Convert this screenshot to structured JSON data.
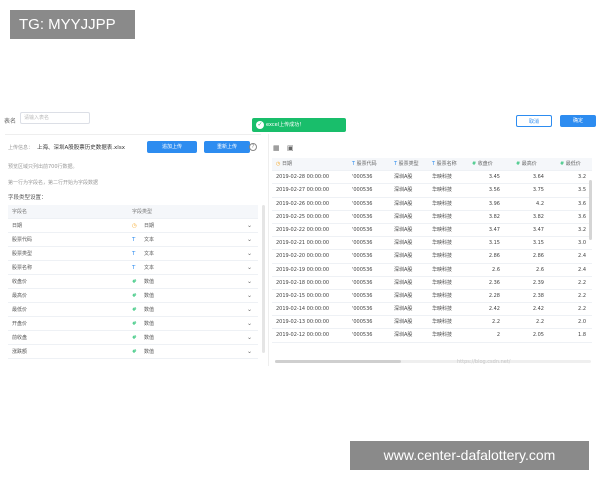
{
  "watermark_top": "TG: MYYJJPP",
  "watermark_bottom": "www.center-dafalottery.com",
  "header": {
    "tablename_label": "表名",
    "tablename_placeholder": "请输入表名",
    "toast_text": "excel上传成功！",
    "cancel_label": "取消",
    "ok_label": "确定"
  },
  "upload": {
    "info_label": "上传信息",
    "filename": "上海、深圳A股股票历史数据表.xlsx",
    "append_label": "追加上传",
    "reupload_label": "重新上传",
    "help_icon": "?"
  },
  "tips": {
    "line1": "预览区域只列出前700行数据。",
    "line2": "第一行为字段名，第二行开始为字段数据"
  },
  "field_section": {
    "title": "字段类型设置：",
    "headers": [
      "字段名",
      "字段类型"
    ],
    "rows": [
      {
        "name": "日期",
        "icon": "clock-icon",
        "type": "日期"
      },
      {
        "name": "股票代码",
        "icon": "T",
        "type": "文本"
      },
      {
        "name": "股票类型",
        "icon": "T",
        "type": "文本"
      },
      {
        "name": "股票名称",
        "icon": "T",
        "type": "文本"
      },
      {
        "name": "收盘价",
        "icon": "#",
        "type": "数值"
      },
      {
        "name": "最高价",
        "icon": "#",
        "type": "数值"
      },
      {
        "name": "最低价",
        "icon": "#",
        "type": "数值"
      },
      {
        "name": "开盘价",
        "icon": "#",
        "type": "数值"
      },
      {
        "name": "前收盘",
        "icon": "#",
        "type": "数值"
      },
      {
        "name": "涨跌额",
        "icon": "#",
        "type": "数值"
      }
    ]
  },
  "preview": {
    "toolbar_icons": [
      "table-icon",
      "image-icon"
    ],
    "headers": [
      {
        "icon": "clock-icon",
        "label": "日期"
      },
      {
        "icon": "T",
        "label": "股票代码"
      },
      {
        "icon": "T",
        "label": "股票类型"
      },
      {
        "icon": "T",
        "label": "股票名称"
      },
      {
        "icon": "#",
        "label": "收盘价"
      },
      {
        "icon": "#",
        "label": "最高价"
      },
      {
        "icon": "#",
        "label": "最低价"
      }
    ],
    "rows": [
      [
        "2019-02-28 00:00:00",
        "'000536",
        "深圳A股",
        "华映科技",
        "3.45",
        "3.64",
        "3.2"
      ],
      [
        "2019-02-27 00:00:00",
        "'000536",
        "深圳A股",
        "华映科技",
        "3.56",
        "3.75",
        "3.5"
      ],
      [
        "2019-02-26 00:00:00",
        "'000536",
        "深圳A股",
        "华映科技",
        "3.96",
        "4.2",
        "3.6"
      ],
      [
        "2019-02-25 00:00:00",
        "'000536",
        "深圳A股",
        "华映科技",
        "3.82",
        "3.82",
        "3.6"
      ],
      [
        "2019-02-22 00:00:00",
        "'000536",
        "深圳A股",
        "华映科技",
        "3.47",
        "3.47",
        "3.2"
      ],
      [
        "2019-02-21 00:00:00",
        "'000536",
        "深圳A股",
        "华映科技",
        "3.15",
        "3.15",
        "3.0"
      ],
      [
        "2019-02-20 00:00:00",
        "'000536",
        "深圳A股",
        "华映科技",
        "2.86",
        "2.86",
        "2.4"
      ],
      [
        "2019-02-19 00:00:00",
        "'000536",
        "深圳A股",
        "华映科技",
        "2.6",
        "2.6",
        "2.4"
      ],
      [
        "2019-02-18 00:00:00",
        "'000536",
        "深圳A股",
        "华映科技",
        "2.36",
        "2.39",
        "2.2"
      ],
      [
        "2019-02-15 00:00:00",
        "'000536",
        "深圳A股",
        "华映科技",
        "2.28",
        "2.38",
        "2.2"
      ],
      [
        "2019-02-14 00:00:00",
        "'000536",
        "深圳A股",
        "华映科技",
        "2.42",
        "2.42",
        "2.2"
      ],
      [
        "2019-02-13 00:00:00",
        "'000536",
        "深圳A股",
        "华映科技",
        "2.2",
        "2.2",
        "2.0"
      ],
      [
        "2019-02-12 00:00:00",
        "'000536",
        "深圳A股",
        "华映科技",
        "2",
        "2.05",
        "1.8"
      ]
    ],
    "url_watermark": "https://blog.csdn.net/"
  },
  "colors": {
    "primary": "#2d8cf0",
    "success": "#19be6b",
    "number_icon": "#19be6b",
    "text_icon": "#2d8cf0",
    "date_icon": "#f5a623"
  }
}
